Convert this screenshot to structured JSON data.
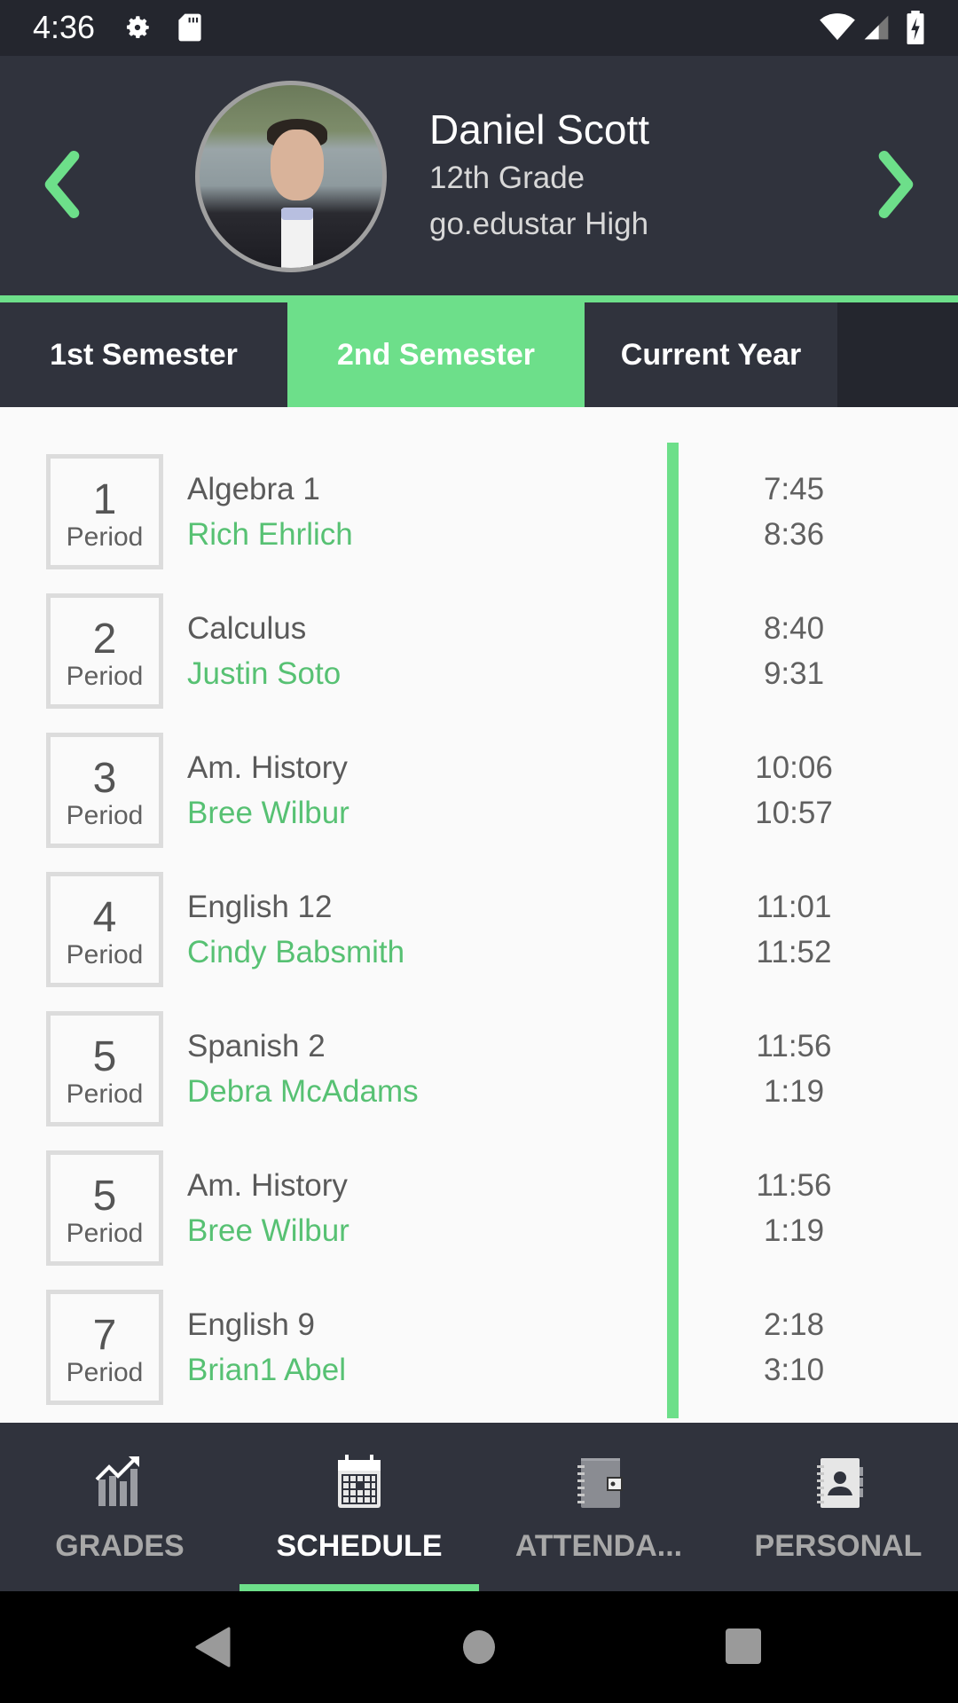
{
  "status_bar": {
    "time": "4:36",
    "icons": [
      "gear-icon",
      "sd-card-icon",
      "wifi-icon",
      "signal-icon",
      "battery-charging-icon"
    ]
  },
  "student": {
    "name": "Daniel Scott",
    "grade": "12th Grade",
    "school": "go.edustar High",
    "avatar": "student-photo"
  },
  "colors": {
    "accent": "#6ddf8a",
    "teacher_text": "#57c173",
    "header_bg": "#30333d",
    "status_bg": "#24262e"
  },
  "tabs": [
    {
      "label": "1st Semester",
      "active": false
    },
    {
      "label": "2nd Semester",
      "active": true
    },
    {
      "label": "Current Year",
      "active": false
    }
  ],
  "schedule": [
    {
      "period": "1",
      "period_label": "Period",
      "class": "Algebra 1",
      "teacher": "Rich Ehrlich",
      "start": "7:45",
      "end": "8:36"
    },
    {
      "period": "2",
      "period_label": "Period",
      "class": "Calculus",
      "teacher": "Justin Soto",
      "start": "8:40",
      "end": "9:31"
    },
    {
      "period": "3",
      "period_label": "Period",
      "class": "Am. History",
      "teacher": "Bree Wilbur",
      "start": "10:06",
      "end": "10:57"
    },
    {
      "period": "4",
      "period_label": "Period",
      "class": "English 12",
      "teacher": "Cindy Babsmith",
      "start": "11:01",
      "end": "11:52"
    },
    {
      "period": "5",
      "period_label": "Period",
      "class": "Spanish 2",
      "teacher": "Debra McAdams",
      "start": "11:56",
      "end": "1:19"
    },
    {
      "period": "5",
      "period_label": "Period",
      "class": "Am. History",
      "teacher": "Bree Wilbur",
      "start": "11:56",
      "end": "1:19"
    },
    {
      "period": "7",
      "period_label": "Period",
      "class": "English 9",
      "teacher": "Brian1 Abel",
      "start": "2:18",
      "end": "3:10"
    }
  ],
  "bottom_nav": [
    {
      "label": "GRADES",
      "icon": "chart-trend-icon",
      "active": false
    },
    {
      "label": "SCHEDULE",
      "icon": "calendar-icon",
      "active": true
    },
    {
      "label": "ATTENDA...",
      "icon": "planner-icon",
      "active": false
    },
    {
      "label": "PERSONAL",
      "icon": "contacts-book-icon",
      "active": false
    }
  ],
  "system_nav": [
    "back-icon",
    "home-icon",
    "recents-icon"
  ]
}
